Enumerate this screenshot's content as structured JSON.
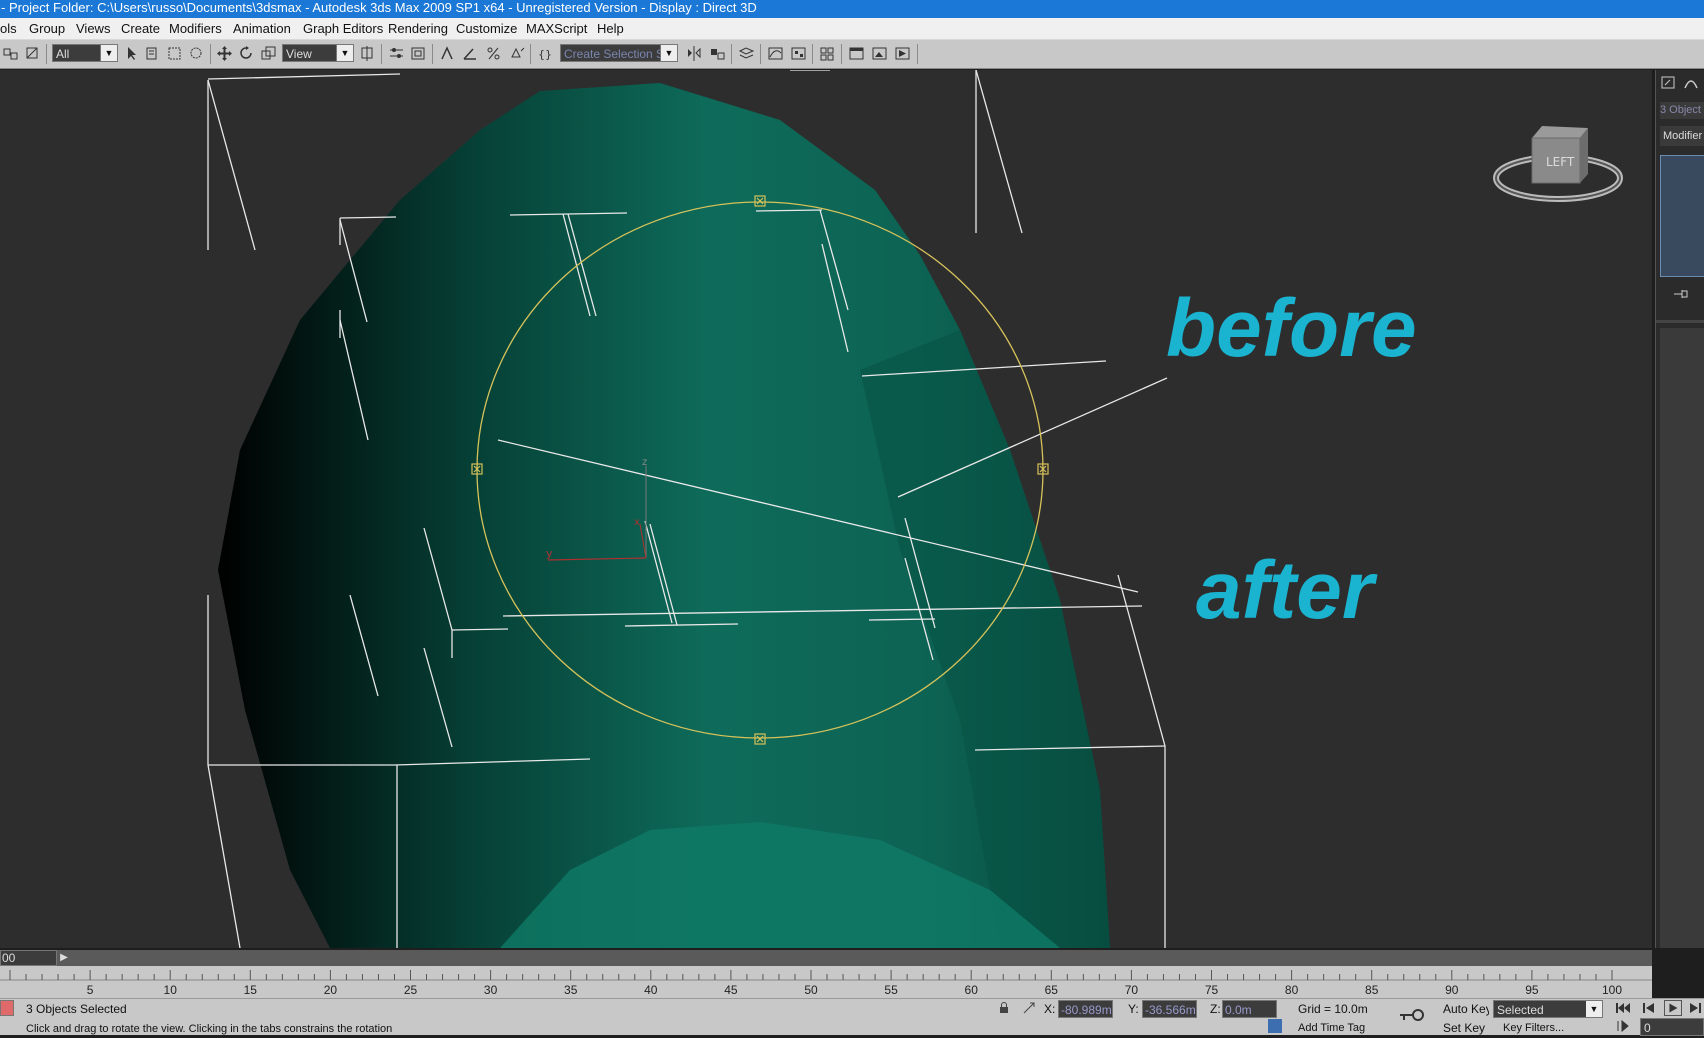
{
  "window": {
    "title": "- Project Folder: C:\\Users\\russo\\Documents\\3dsmax      - Autodesk 3ds Max  2009 SP1  x64   - Unregistered Version     - Display : Direct 3D"
  },
  "menu": {
    "items": [
      "ols",
      "Group",
      "Views",
      "Create",
      "Modifiers",
      "Animation",
      "Graph Editors",
      "Rendering",
      "Customize",
      "MAXScript",
      "Help"
    ]
  },
  "toolbar": {
    "selection_filter": "All",
    "reference_coord": "View",
    "named_selection_placeholder": "Create Selection Se"
  },
  "viewport": {
    "label_before": "before",
    "label_after": "after",
    "viewcube_label": "LEFT",
    "axis_z": "z",
    "axis_y": "y",
    "axis_x": "x",
    "annotation_color": "#1ab3d0",
    "mesh_color": "#0e6b5a",
    "selection_circle_color": "#d6c25a"
  },
  "command_panel": {
    "object_count": "3 Object",
    "modifier_list": "Modifier"
  },
  "time_slider": {
    "frame_label": "00",
    "next_icon": "chevron-right-icon"
  },
  "track_bar": {
    "ticks": [
      "5",
      "10",
      "15",
      "20",
      "25",
      "30",
      "35",
      "40",
      "45",
      "50",
      "55",
      "60",
      "65",
      "70",
      "75",
      "80",
      "85",
      "90",
      "95",
      "100"
    ]
  },
  "status": {
    "selection": "3 Objects Selected",
    "prompt": "Click and drag to rotate the view. Clicking in the tabs constrains the rotation",
    "x_label": "X:",
    "x_value": "-80.989m",
    "y_label": "Y:",
    "y_value": "-36.566m",
    "z_label": "Z:",
    "z_value": "0.0m",
    "grid": "Grid = 10.0m",
    "auto_key": "Auto Key",
    "set_key": "Set Key",
    "key_mode": "Selected",
    "key_filters": "Key Filters...",
    "add_time_tag": "Add Time Tag",
    "frame_value": "0"
  }
}
